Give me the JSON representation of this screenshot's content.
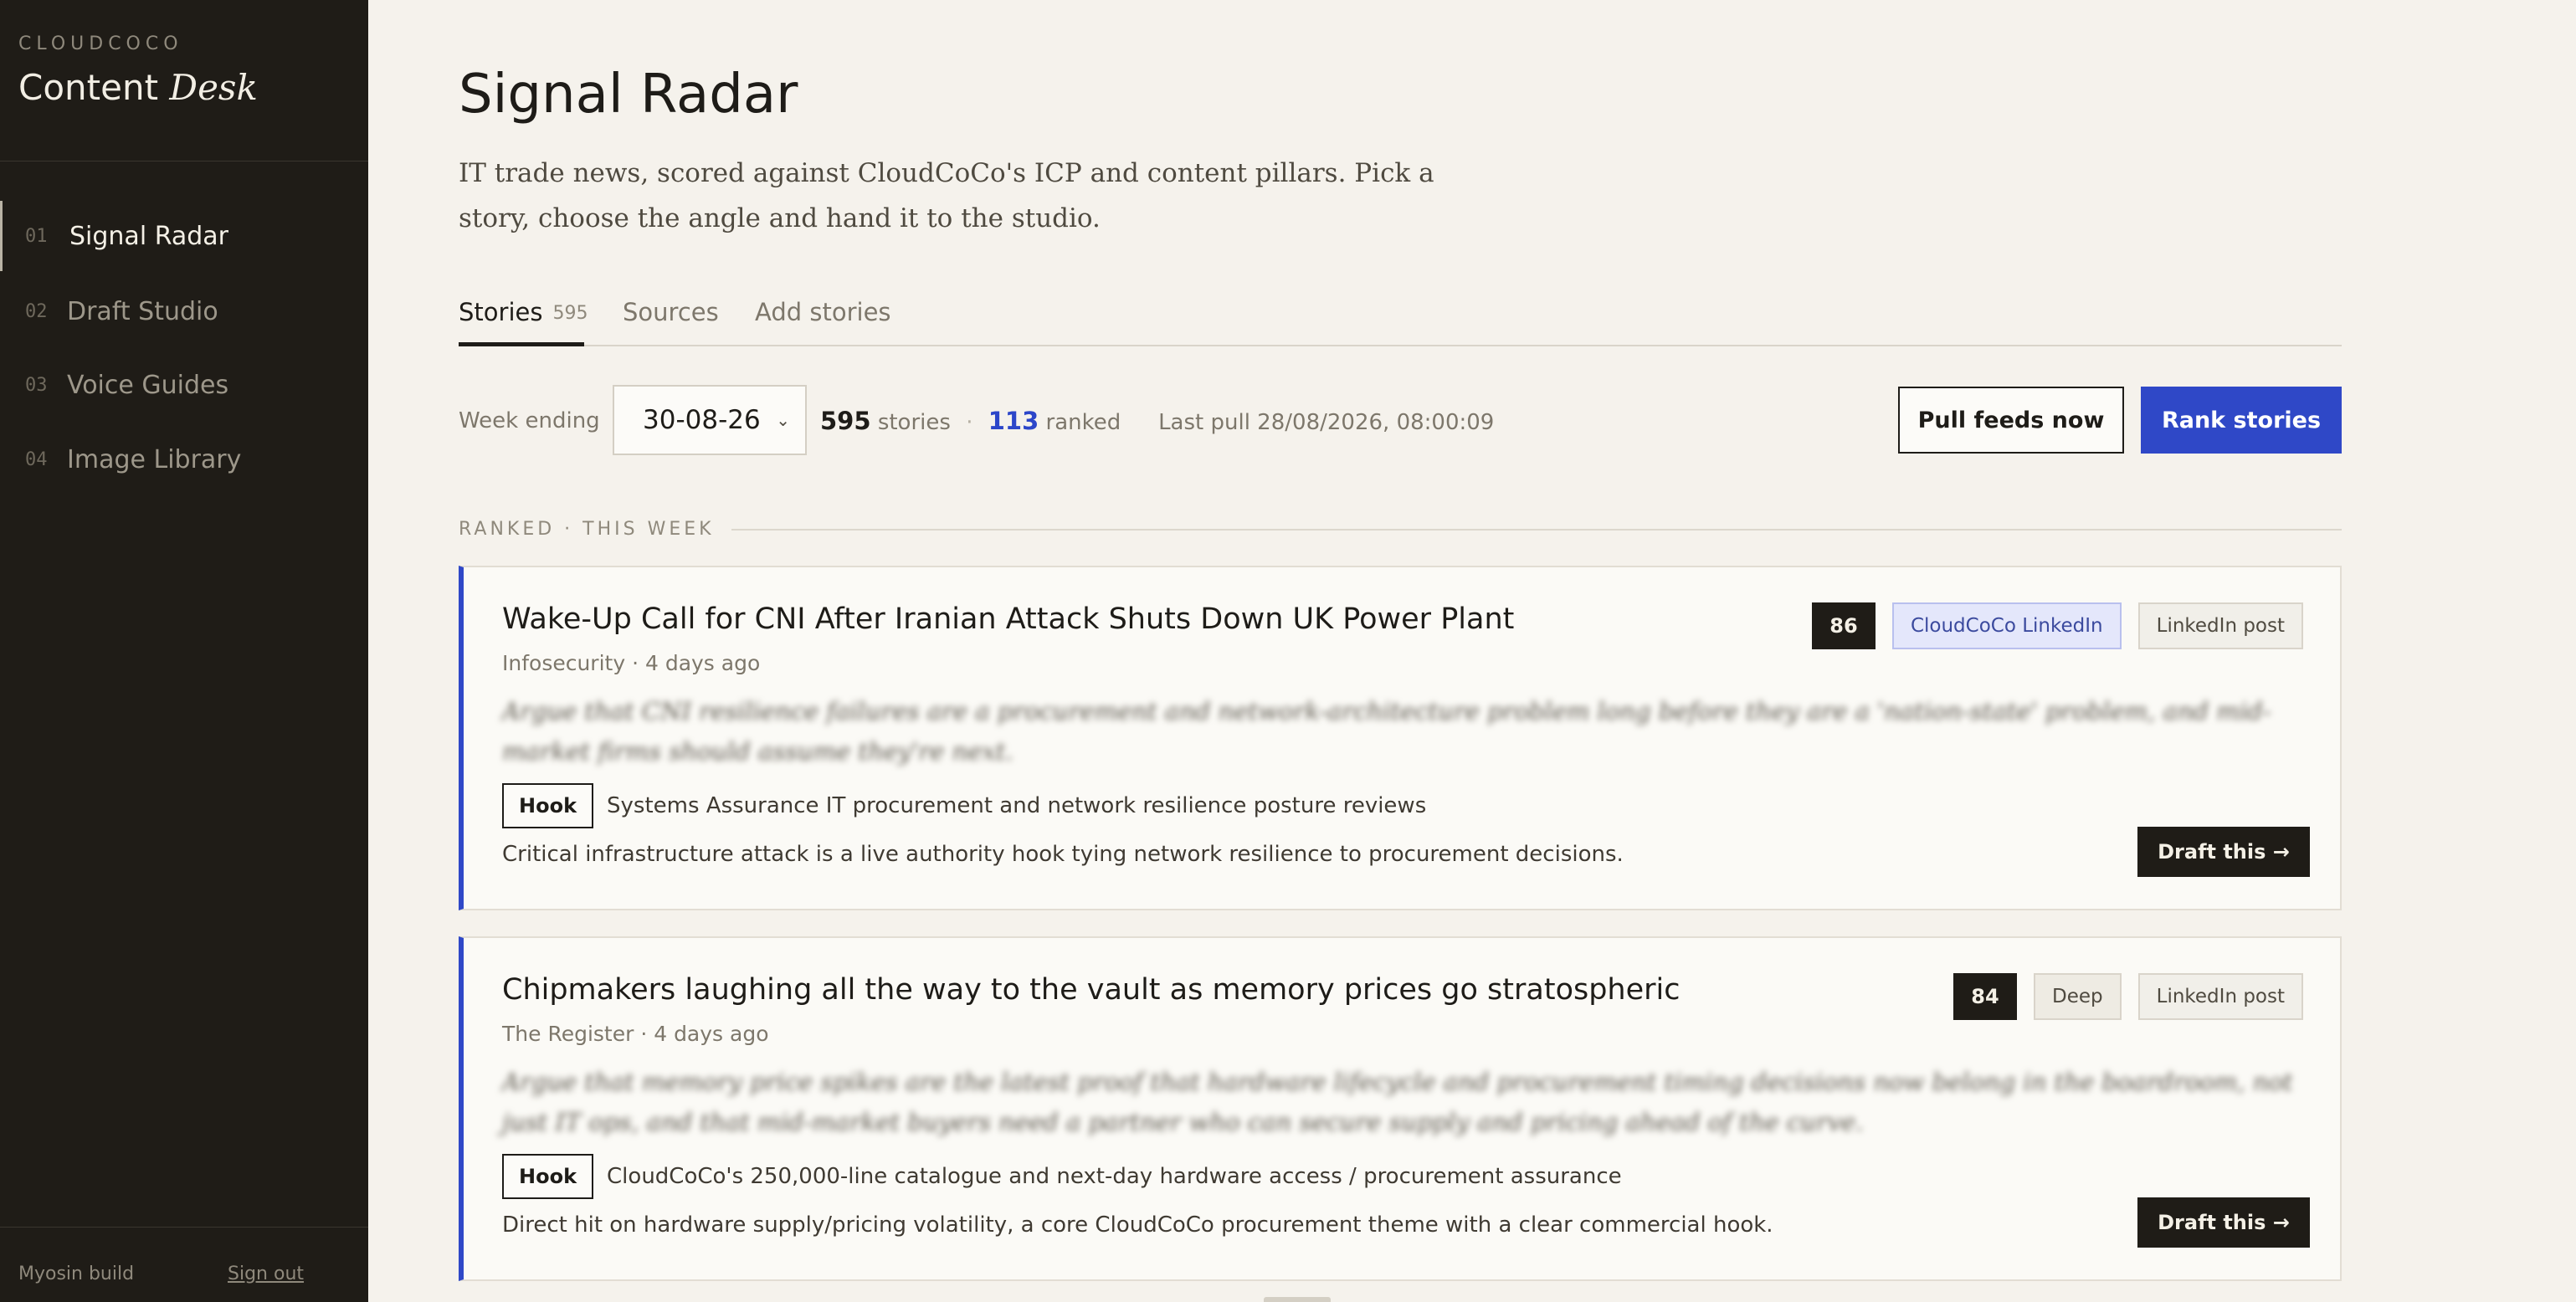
{
  "sidebar": {
    "brand_small": "CLOUDCOCO",
    "brand_main": "Content",
    "brand_accent": "Desk",
    "nav": [
      {
        "num": "01",
        "label": "Signal Radar"
      },
      {
        "num": "02",
        "label": "Draft Studio"
      },
      {
        "num": "03",
        "label": "Voice Guides"
      },
      {
        "num": "04",
        "label": "Image Library"
      }
    ],
    "footer": {
      "build": "Myosin build",
      "signout": "Sign out"
    }
  },
  "page": {
    "title": "Signal Radar",
    "description": "IT trade news, scored against CloudCoCo's ICP and content pillars. Pick a story, choose the angle and hand it to the studio."
  },
  "tabs": [
    {
      "label": "Stories",
      "count": "595"
    },
    {
      "label": "Sources",
      "count": ""
    },
    {
      "label": "Add stories",
      "count": ""
    }
  ],
  "toolbar": {
    "week_label": "Week ending",
    "week_value": "30-08-26",
    "story_count": "595",
    "story_label": "stories",
    "ranked_count": "113",
    "ranked_label": "ranked",
    "last_pull": "Last pull 28/08/2026, 08:00:09",
    "pull_button": "Pull feeds now",
    "rank_button": "Rank stories"
  },
  "section": {
    "label": "RANKED · THIS WEEK"
  },
  "stories": [
    {
      "title": "Wake-Up Call for CNI After Iranian Attack Shuts Down UK Power Plant",
      "meta": "Infosecurity · 4 days ago",
      "score": "86",
      "tag": "CloudCoCo LinkedIn",
      "format": "LinkedIn post",
      "angle": "Argue that CNI resilience failures are a procurement and network-architecture problem long before they are a 'nation-state' problem, and mid-market firms should assume they're next.",
      "hook_label": "Hook",
      "hook": "Systems Assurance IT procurement and network resilience posture reviews",
      "rationale": "Critical infrastructure attack is a live authority hook tying network resilience to procurement decisions.",
      "draft_button": "Draft this →"
    },
    {
      "title": "Chipmakers laughing all the way to the vault as memory prices go stratospheric",
      "meta": "The Register · 4 days ago",
      "score": "84",
      "tag": "Deep",
      "format": "LinkedIn post",
      "angle": "Argue that memory price spikes are the latest proof that hardware lifecycle and procurement timing decisions now belong in the boardroom, not just IT ops, and that mid-market buyers need a partner who can secure supply and pricing ahead of the curve.",
      "hook_label": "Hook",
      "hook": "CloudCoCo's 250,000-line catalogue and next-day hardware access / procurement assurance",
      "rationale": "Direct hit on hardware supply/pricing volatility, a core CloudCoCo procurement theme with a clear commercial hook.",
      "draft_button": "Draft this →"
    }
  ]
}
